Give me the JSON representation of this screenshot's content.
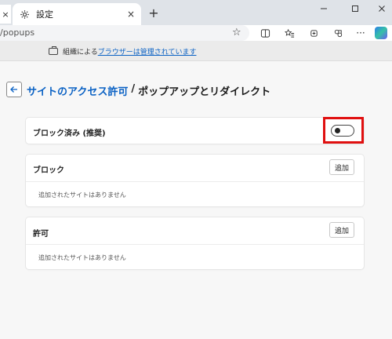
{
  "browser": {
    "tab_title": "設定",
    "tab_close": "×",
    "left_tab_close": "×",
    "new_tab": "+",
    "address": "/popups",
    "window_controls": {
      "minimize": "─",
      "maximize": "☐",
      "close": "✕"
    }
  },
  "banner": {
    "prefix": "組織による",
    "link": "ブラウザーは管理されています"
  },
  "header": {
    "breadcrumb": "サイトのアクセス許可",
    "separator": "/",
    "title": "ポップアップとリダイレクト"
  },
  "blocked_setting": {
    "label": "ブロック済み (推奨)",
    "toggle_on": false
  },
  "block_section": {
    "title": "ブロック",
    "add_label": "追加",
    "empty_text": "追加されたサイトはありません"
  },
  "allow_section": {
    "title": "許可",
    "add_label": "追加",
    "empty_text": "追加されたサイトはありません"
  },
  "colors": {
    "accent": "#0b62c4",
    "highlight": "#e01010"
  },
  "icons": [
    "gear-icon",
    "star-icon",
    "split-screen-icon",
    "favorites-icon",
    "collections-icon",
    "extensions-icon",
    "more-icon",
    "copilot-icon",
    "back-arrow-icon",
    "briefcase-icon"
  ]
}
